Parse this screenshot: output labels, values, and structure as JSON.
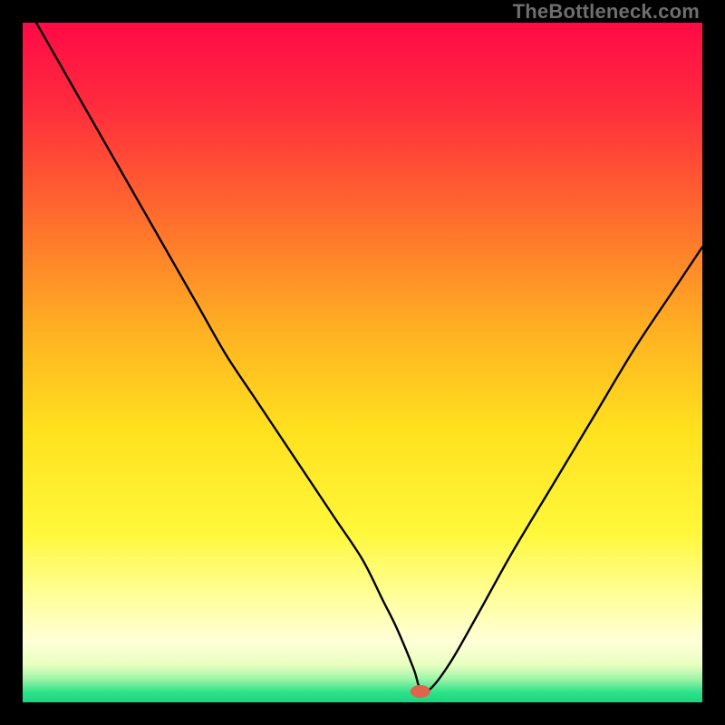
{
  "watermark": "TheBottleneck.com",
  "chart_data": {
    "type": "line",
    "title": "",
    "xlabel": "",
    "ylabel": "",
    "xlim": [
      0,
      100
    ],
    "ylim": [
      0,
      100
    ],
    "background_gradient": {
      "stops": [
        {
          "offset": 0.0,
          "color": "#ff0a46"
        },
        {
          "offset": 0.12,
          "color": "#ff2b3d"
        },
        {
          "offset": 0.28,
          "color": "#ff6a2e"
        },
        {
          "offset": 0.45,
          "color": "#ffb022"
        },
        {
          "offset": 0.6,
          "color": "#ffe11e"
        },
        {
          "offset": 0.75,
          "color": "#fff83a"
        },
        {
          "offset": 0.85,
          "color": "#ffffa0"
        },
        {
          "offset": 0.91,
          "color": "#ffffd8"
        },
        {
          "offset": 0.945,
          "color": "#e8ffc0"
        },
        {
          "offset": 0.965,
          "color": "#a0f5a8"
        },
        {
          "offset": 0.985,
          "color": "#2fe28a"
        },
        {
          "offset": 1.0,
          "color": "#17d77e"
        }
      ]
    },
    "series": [
      {
        "name": "bottleneck-curve",
        "x": [
          2,
          6,
          10,
          14,
          18,
          22,
          26,
          30,
          34,
          38,
          42,
          46,
          50,
          53,
          55,
          57.5,
          58.5,
          60,
          63,
          67,
          72,
          78,
          84,
          90,
          96,
          100
        ],
        "y": [
          100,
          93,
          86,
          79,
          72,
          65,
          58,
          51,
          45,
          39,
          33,
          27,
          21,
          15,
          11,
          5,
          2,
          2,
          6,
          13,
          22,
          32,
          42,
          52,
          61,
          67
        ]
      }
    ],
    "marker": {
      "name": "optimal-point",
      "x": 58.5,
      "y": 1.6,
      "color": "#e0634c",
      "rx": 11,
      "ry": 7
    }
  }
}
